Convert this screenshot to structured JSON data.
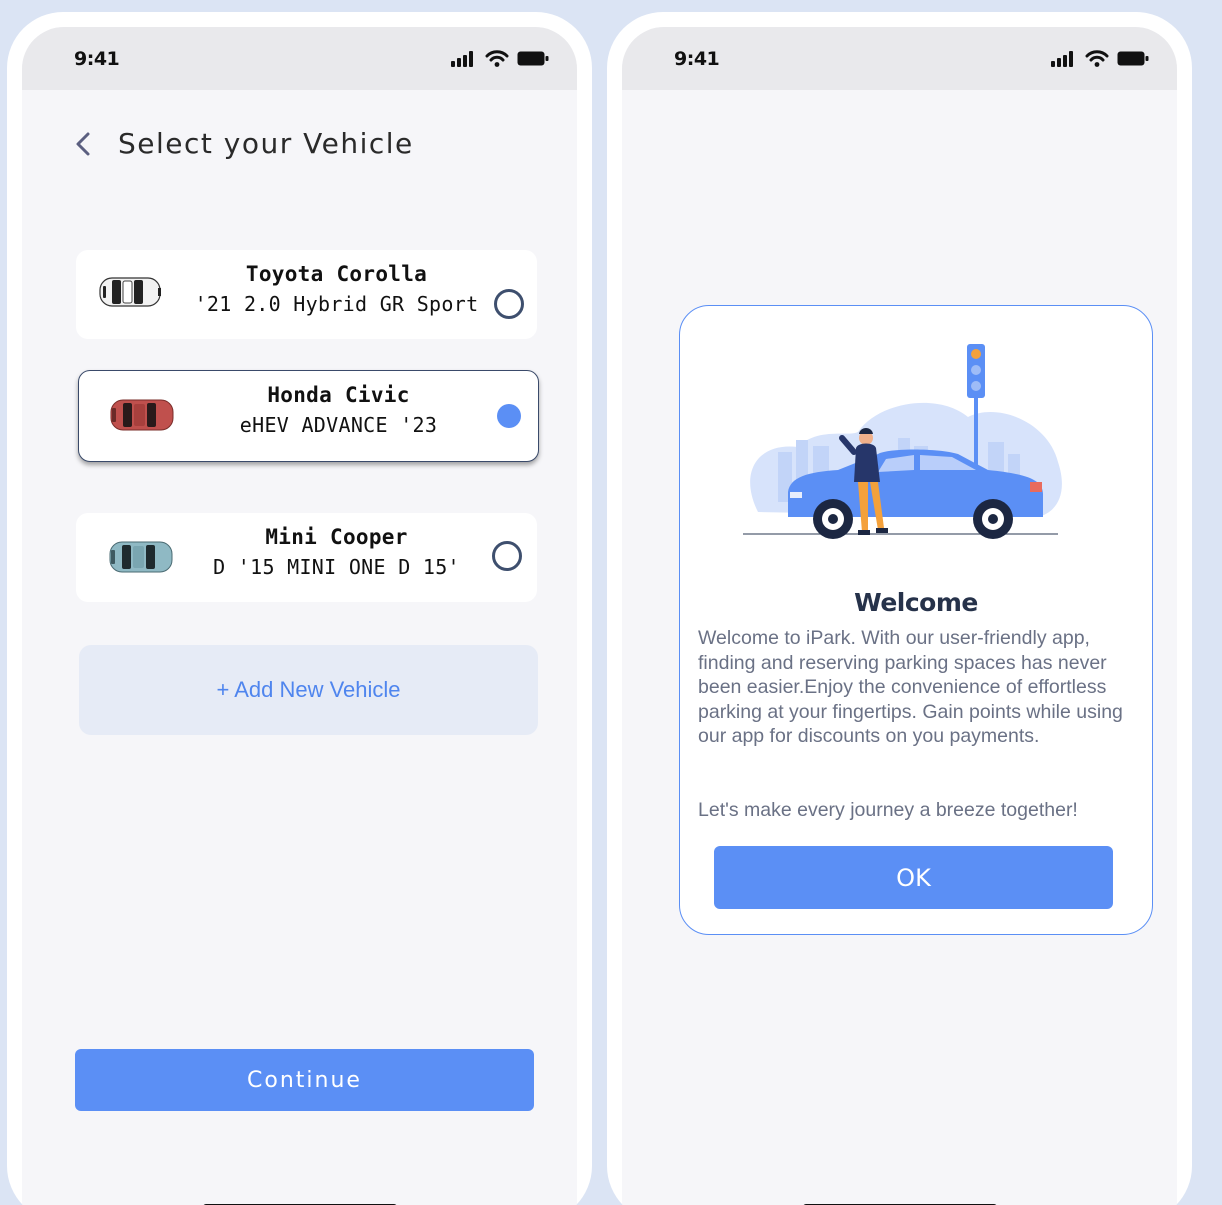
{
  "screen1": {
    "status_time": "9:41",
    "title": "Select your Vehicle",
    "vehicles": [
      {
        "name": "Toyota Corolla",
        "model": "'21 2.0 Hybrid GR Sport",
        "color": "#ffffff",
        "selected": false
      },
      {
        "name": "Honda Civic",
        "model": "eHEV ADVANCE '23",
        "color": "#c0504d",
        "selected": true
      },
      {
        "name": "Mini Cooper",
        "model": "D '15 MINI ONE D 15'",
        "color": "#8fb9c4",
        "selected": false
      }
    ],
    "add_label": "+ Add New Vehicle",
    "continue_label": "Continue"
  },
  "screen2": {
    "status_time": "9:41",
    "modal": {
      "title": "Welcome",
      "body": "Welcome to iPark. With our user-friendly app, finding and reserving parking spaces has never been easier.Enjoy the convenience of effortless parking at your fingertips. Gain points while using our app for discounts on you payments.",
      "tagline": "Let's make every journey a breeze together!",
      "ok_label": "OK"
    }
  },
  "colors": {
    "accent": "#5b8ff5",
    "background": "#dbe4f4",
    "card_bg": "#ffffff",
    "add_bg": "#e6ebf6"
  },
  "icons": [
    "chevron-left-icon",
    "signal-icon",
    "wifi-icon",
    "battery-icon",
    "car-top-icon",
    "parking-illustration"
  ]
}
